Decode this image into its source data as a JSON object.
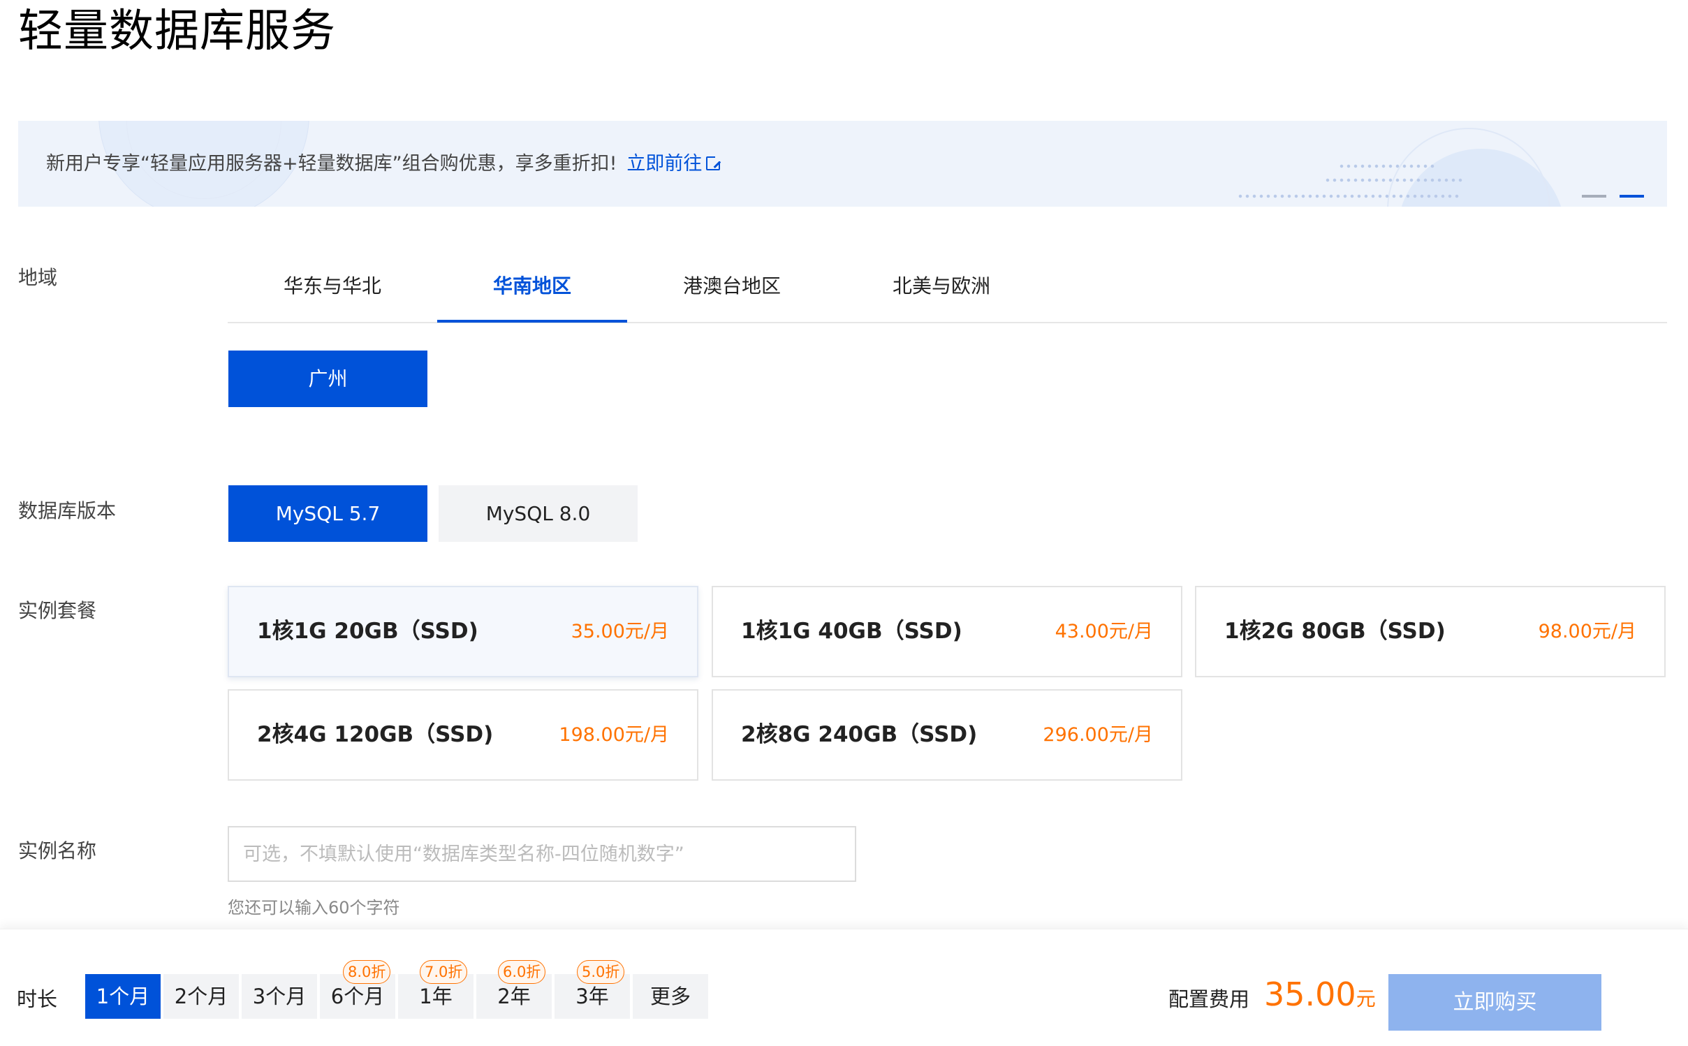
{
  "page": {
    "title": "轻量数据库服务"
  },
  "banner": {
    "text": "新用户专享“轻量应用服务器+轻量数据库”组合购优惠，享多重折扣!",
    "link": "立即前往"
  },
  "region": {
    "label": "地域",
    "tabs": [
      "华东与华北",
      "华南地区",
      "港澳台地区",
      "北美与欧洲"
    ],
    "active_tab": "华南地区",
    "cities": [
      "广州"
    ],
    "selected_city": "广州"
  },
  "db_version": {
    "label": "数据库版本",
    "options": [
      "MySQL 5.7",
      "MySQL 8.0"
    ],
    "selected": "MySQL 5.7"
  },
  "package": {
    "label": "实例套餐",
    "items": [
      {
        "spec": "1核1G 20GB（SSD)",
        "price": "35.00元/月"
      },
      {
        "spec": "1核1G 40GB（SSD)",
        "price": "43.00元/月"
      },
      {
        "spec": "1核2G 80GB（SSD)",
        "price": "98.00元/月"
      },
      {
        "spec": "2核4G 120GB（SSD)",
        "price": "198.00元/月"
      },
      {
        "spec": "2核8G 240GB（SSD)",
        "price": "296.00元/月"
      }
    ],
    "selected": "1核1G 20GB（SSD)"
  },
  "instance_name": {
    "label": "实例名称",
    "value": "",
    "placeholder": "可选，不填默认使用“数据库类型名称-四位随机数字”",
    "hint": "您还可以输入60个字符"
  },
  "duration": {
    "label": "时长",
    "options": [
      {
        "label": "1个月",
        "badge": ""
      },
      {
        "label": "2个月",
        "badge": ""
      },
      {
        "label": "3个月",
        "badge": ""
      },
      {
        "label": "6个月",
        "badge": "8.0折"
      },
      {
        "label": "1年",
        "badge": "7.0折"
      },
      {
        "label": "2年",
        "badge": "6.0折"
      },
      {
        "label": "3年",
        "badge": "5.0折"
      },
      {
        "label": "更多",
        "badge": ""
      }
    ],
    "selected": "1个月"
  },
  "summary": {
    "fee_label": "配置费用",
    "fee_amount": "35.00",
    "fee_unit": "元",
    "buy_label": "立即购买"
  },
  "colors": {
    "primary": "#0052d9",
    "price_orange": "#ff7200",
    "buy_disabled": "#8eb3ee"
  }
}
